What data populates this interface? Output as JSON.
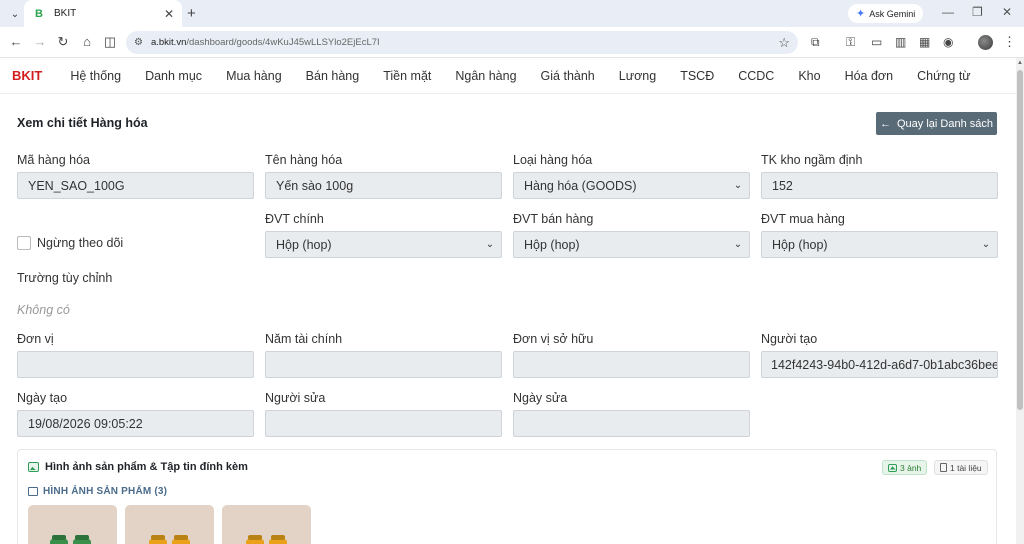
{
  "browser": {
    "tab_title": "BKIT",
    "tab_favicon": "B",
    "ask_gemini": "Ask Gemini",
    "url_host": "a.bkit.vn",
    "url_path": "/dashboard/goods/4wKuJ45wLLSYlo2EjEcL7I"
  },
  "nav": {
    "brand": "BKIT",
    "items": [
      "Hệ thống",
      "Danh mục",
      "Mua hàng",
      "Bán hàng",
      "Tiền mặt",
      "Ngân hàng",
      "Giá thành",
      "Lương",
      "TSCĐ",
      "CCDC",
      "Kho",
      "Hóa đơn",
      "Chứng từ"
    ]
  },
  "page": {
    "title": "Xem chi tiết Hàng hóa",
    "back_button": "Quay lại Danh sách"
  },
  "fields": {
    "ma_hang_hoa": {
      "label": "Mã hàng hóa",
      "value": "YEN_SAO_100G"
    },
    "ten_hang_hoa": {
      "label": "Tên hàng hóa",
      "value": "Yến sào 100g"
    },
    "loai_hang_hoa": {
      "label": "Loại hàng hóa",
      "value": "Hàng hóa (GOODS)"
    },
    "tk_kho": {
      "label": "TK kho ngầm định",
      "value": "152"
    },
    "ngung_theo_doi": {
      "label": "Ngừng theo dõi",
      "checked": false
    },
    "dvt_chinh": {
      "label": "ĐVT chính",
      "value": "Hộp (hop)"
    },
    "dvt_ban_hang": {
      "label": "ĐVT bán hàng",
      "value": "Hộp (hop)"
    },
    "dvt_mua_hang": {
      "label": "ĐVT mua hàng",
      "value": "Hộp (hop)"
    },
    "truong_tuy_chinh": {
      "label": "Trường tùy chỉnh",
      "empty_text": "Không có"
    },
    "don_vi": {
      "label": "Đơn vị",
      "value": ""
    },
    "nam_tai_chinh": {
      "label": "Năm tài chính",
      "value": ""
    },
    "don_vi_so_huu": {
      "label": "Đơn vị sở hữu",
      "value": ""
    },
    "nguoi_tao": {
      "label": "Người tạo",
      "value": "142f4243-94b0-412d-a6d7-0b1abc36bee"
    },
    "ngay_tao": {
      "label": "Ngày tạo",
      "value": "19/08/2026 09:05:22"
    },
    "nguoi_sua": {
      "label": "Người sửa",
      "value": ""
    },
    "ngay_sua": {
      "label": "Ngày sửa",
      "value": ""
    }
  },
  "attachments": {
    "title": "Hình ảnh sản phẩm & Tập tin đính kèm",
    "images_badge": "3 ảnh",
    "files_badge": "1 tài liệu",
    "section_label": "HÌNH ẢNH SẢN PHẨM (3)",
    "thumb_colors": [
      "#3a8f4a",
      "#e9a21a",
      "#e9a21a"
    ]
  }
}
